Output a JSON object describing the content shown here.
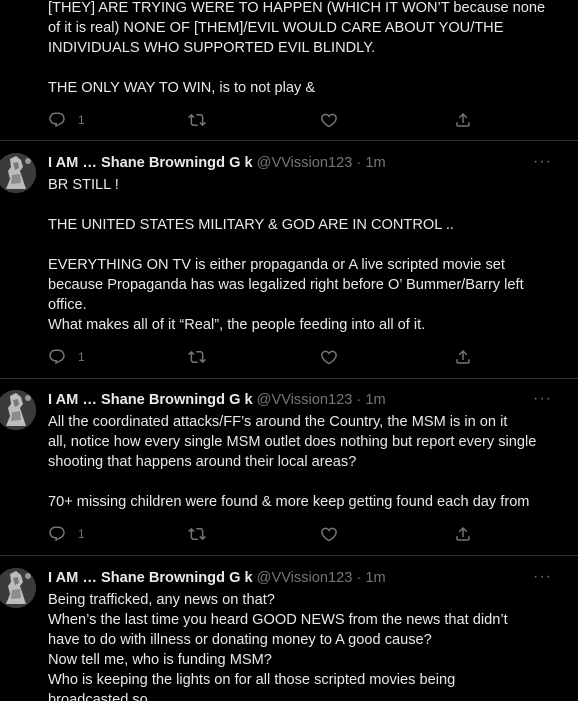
{
  "top": {
    "lines": [
      "[THEY] ARE TRYING WERE TO HAPPEN (WHICH IT WON’T because none",
      "of it is real) NONE OF [THEM]/EVIL WOULD CARE ABOUT YOU/THE",
      "INDIVIDUALS WHO SUPPORTED EVIL BLINDLY.",
      "",
      "THE ONLY WAY TO WIN, is to not play &"
    ],
    "reply_count": "1"
  },
  "tweets": [
    {
      "name": "I AM … Shane Browningd G k",
      "handle": "@VVission123",
      "sep": "·",
      "time": "1m",
      "lines": [
        "BR STILL !",
        "",
        "THE UNITED STATES MILITARY & GOD ARE IN CONTROL ..",
        "",
        "EVERYTHING ON TV is either propaganda or A live scripted movie set",
        "because Propaganda has was legalized right before O’ Bummer/Barry left",
        "office.",
        "What makes all of it “Real”, the people feeding into all of it."
      ],
      "reply_count": "1"
    },
    {
      "name": "I AM … Shane Browningd G k",
      "handle": "@VVission123",
      "sep": "·",
      "time": "1m",
      "lines": [
        "All the coordinated attacks/FF’s around the Country, the MSM is in on it",
        "all, notice how every single MSM outlet does nothing but report every single",
        "shooting that happens around their local areas?",
        "",
        "70+ missing children were found & more keep getting found each day from"
      ],
      "reply_count": "1"
    },
    {
      "name": "I AM … Shane Browningd G k",
      "handle": "@VVission123",
      "sep": "·",
      "time": "1m",
      "lines": [
        "Being trafficked, any news on that?",
        "When’s the last time you heard GOOD NEWS from the news that didn’t",
        "have to do with illness or donating money to A good cause?",
        "Now tell me, who is funding MSM?",
        "Who is keeping the lights on for all those scripted movies being",
        "broadcasted so…"
      ]
    }
  ],
  "more_label": "···"
}
